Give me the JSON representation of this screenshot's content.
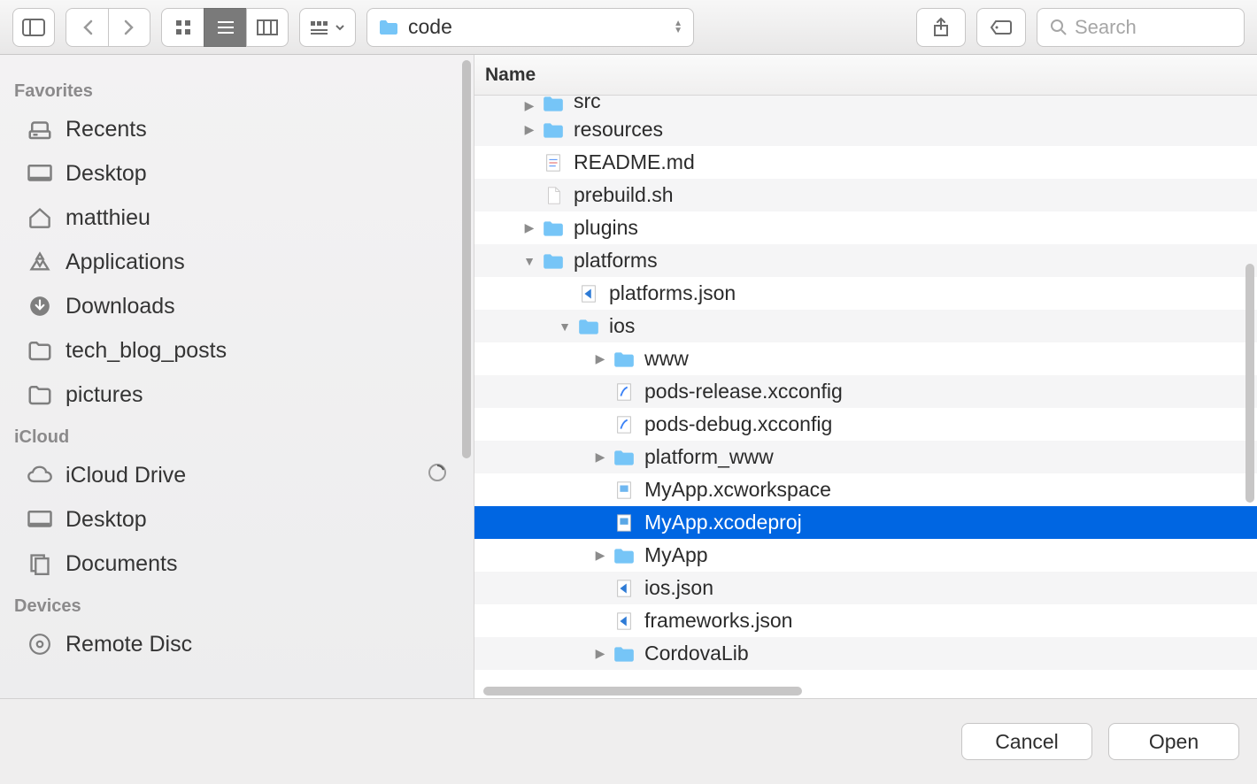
{
  "toolbar": {
    "current_folder": "code",
    "search_placeholder": "Search"
  },
  "sidebar": {
    "sections": [
      {
        "title": "Favorites",
        "items": [
          {
            "label": "Recents",
            "icon": "recents"
          },
          {
            "label": "Desktop",
            "icon": "desktop"
          },
          {
            "label": "matthieu",
            "icon": "home"
          },
          {
            "label": "Applications",
            "icon": "apps"
          },
          {
            "label": "Downloads",
            "icon": "download"
          },
          {
            "label": "tech_blog_posts",
            "icon": "folder"
          },
          {
            "label": "pictures",
            "icon": "folder"
          }
        ]
      },
      {
        "title": "iCloud",
        "items": [
          {
            "label": "iCloud Drive",
            "icon": "cloud",
            "tail": "progress"
          },
          {
            "label": "Desktop",
            "icon": "desktop"
          },
          {
            "label": "Documents",
            "icon": "documents"
          }
        ]
      },
      {
        "title": "Devices",
        "items": [
          {
            "label": "Remote Disc",
            "icon": "disc"
          }
        ]
      }
    ]
  },
  "filelist": {
    "header": "Name",
    "rows": [
      {
        "indent": 0,
        "disclosure": "right",
        "icon": "folder",
        "name": "src",
        "cut_top": true
      },
      {
        "indent": 0,
        "disclosure": "right",
        "icon": "folder",
        "name": "resources"
      },
      {
        "indent": 0,
        "disclosure": "none",
        "icon": "md",
        "name": "README.md"
      },
      {
        "indent": 0,
        "disclosure": "none",
        "icon": "blank",
        "name": "prebuild.sh"
      },
      {
        "indent": 0,
        "disclosure": "right",
        "icon": "folder",
        "name": "plugins"
      },
      {
        "indent": 0,
        "disclosure": "down",
        "icon": "folder",
        "name": "platforms"
      },
      {
        "indent": 1,
        "disclosure": "none",
        "icon": "vscode",
        "name": "platforms.json"
      },
      {
        "indent": 1,
        "disclosure": "down",
        "icon": "folder",
        "name": "ios"
      },
      {
        "indent": 2,
        "disclosure": "right",
        "icon": "folder",
        "name": "www"
      },
      {
        "indent": 2,
        "disclosure": "none",
        "icon": "xcconfig",
        "name": "pods-release.xcconfig"
      },
      {
        "indent": 2,
        "disclosure": "none",
        "icon": "xcconfig",
        "name": "pods-debug.xcconfig"
      },
      {
        "indent": 2,
        "disclosure": "right",
        "icon": "folder",
        "name": "platform_www"
      },
      {
        "indent": 2,
        "disclosure": "none",
        "icon": "xcws",
        "name": "MyApp.xcworkspace"
      },
      {
        "indent": 2,
        "disclosure": "none",
        "icon": "xcproj",
        "name": "MyApp.xcodeproj",
        "selected": true
      },
      {
        "indent": 2,
        "disclosure": "right",
        "icon": "folder",
        "name": "MyApp"
      },
      {
        "indent": 2,
        "disclosure": "none",
        "icon": "vscode",
        "name": "ios.json"
      },
      {
        "indent": 2,
        "disclosure": "none",
        "icon": "vscode",
        "name": "frameworks.json"
      },
      {
        "indent": 2,
        "disclosure": "right",
        "icon": "folder",
        "name": "CordovaLib"
      }
    ]
  },
  "footer": {
    "cancel": "Cancel",
    "open": "Open"
  }
}
